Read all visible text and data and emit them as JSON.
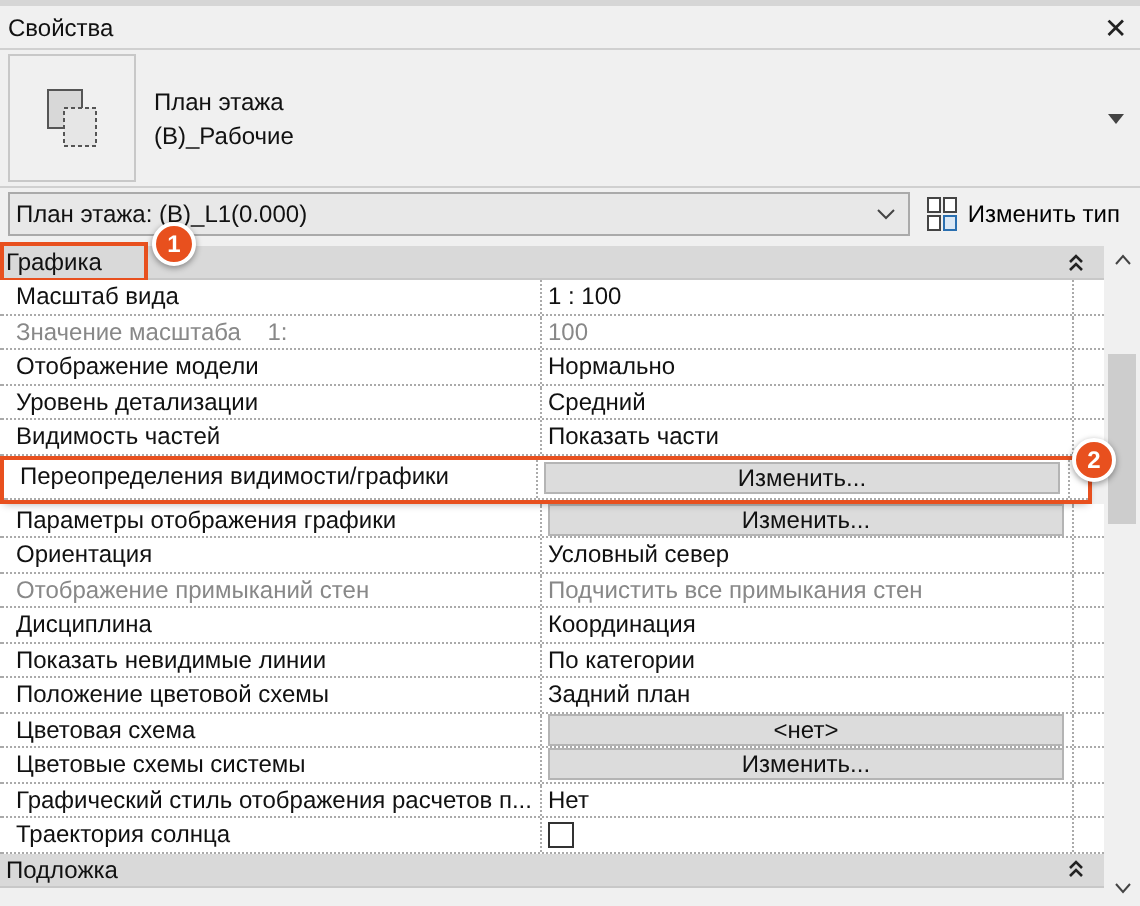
{
  "window": {
    "title": "Свойства",
    "close": "✕"
  },
  "type_selector": {
    "line1": "План этажа",
    "line2": "(B)_Рабочие"
  },
  "instance_dropdown": {
    "value": "План этажа: (B)_L1(0.000)",
    "edit_type": "Изменить тип"
  },
  "groups": [
    {
      "name": "Графика",
      "expanded": true,
      "callout": "1",
      "rows": [
        {
          "label": "Масштаб вида",
          "kind": "text",
          "value": "1 : 100",
          "disabled": false
        },
        {
          "label": "Значение масштаба    1:",
          "kind": "text",
          "value": "100",
          "disabled": true
        },
        {
          "label": "Отображение модели",
          "kind": "text",
          "value": "Нормально",
          "disabled": false
        },
        {
          "label": "Уровень детализации",
          "kind": "text",
          "value": "Средний",
          "disabled": false
        },
        {
          "label": "Видимость частей",
          "kind": "text",
          "value": "Показать части",
          "disabled": false
        },
        {
          "label": "Переопределения видимости/графики",
          "kind": "button",
          "value": "Изменить...",
          "disabled": false,
          "callout": "2"
        },
        {
          "label": "Параметры отображения графики",
          "kind": "button",
          "value": "Изменить...",
          "disabled": false
        },
        {
          "label": "Ориентация",
          "kind": "text",
          "value": "Условный север",
          "disabled": false
        },
        {
          "label": "Отображение примыканий стен",
          "kind": "text",
          "value": "Подчистить все примыкания стен",
          "disabled": true
        },
        {
          "label": "Дисциплина",
          "kind": "text",
          "value": "Координация",
          "disabled": false
        },
        {
          "label": "Показать невидимые линии",
          "kind": "text",
          "value": "По категории",
          "disabled": false
        },
        {
          "label": "Положение цветовой схемы",
          "kind": "text",
          "value": "Задний план",
          "disabled": false
        },
        {
          "label": "Цветовая схема",
          "kind": "button",
          "value": "<нет>",
          "disabled": false
        },
        {
          "label": "Цветовые схемы системы",
          "kind": "button",
          "value": "Изменить...",
          "disabled": false
        },
        {
          "label": "Графический стиль отображения расчетов п...",
          "kind": "text",
          "value": "Нет",
          "disabled": false
        },
        {
          "label": "Траектория солнца",
          "kind": "checkbox",
          "checked": false,
          "disabled": false
        }
      ]
    },
    {
      "name": "Подложка",
      "expanded": true
    }
  ]
}
